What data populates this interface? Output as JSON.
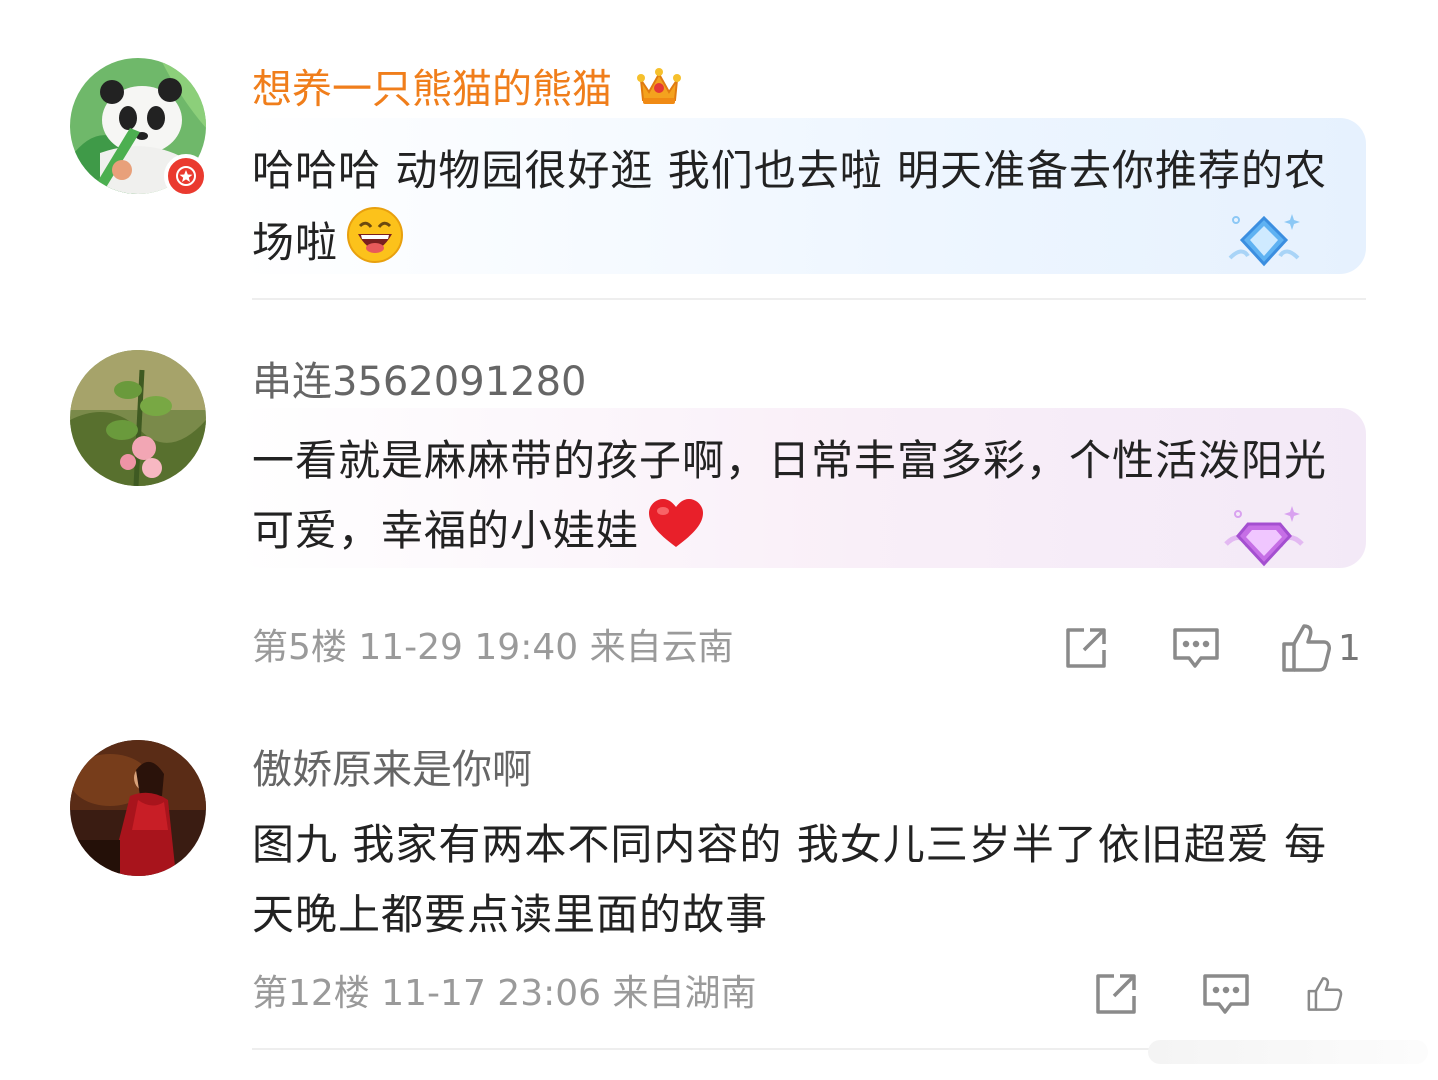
{
  "comments": [
    {
      "username": "想养一只熊猫的熊猫",
      "text": "哈哈哈 动物园很好逛 我们也去啦 明天准备去你推荐的农场啦",
      "emoji": "laughing-emoji",
      "avatar_icon": "panda-avatar",
      "badge_icon": "red-star-badge",
      "vip_icon": "crown-icon",
      "deco_icon": "blue-diamond-icon"
    },
    {
      "username": "串连3562091280",
      "text": "一看就是麻麻带的孩子啊，日常丰富多彩，个性活泼阳光可爱，幸福的小娃娃",
      "emoji": "red-heart-emoji",
      "floor_meta": "第5楼 11-29 19:40 来自云南",
      "like_count": "1",
      "avatar_icon": "plant-avatar",
      "deco_icon": "purple-diamond-icon"
    },
    {
      "username": "傲娇原来是你啊",
      "text": "图九 我家有两本不同内容的 我女儿三岁半了依旧超爱  每天晚上都要点读里面的故事",
      "floor_meta": "第12楼 11-17 23:06 来自湖南",
      "like_count": "",
      "avatar_icon": "red-dress-avatar"
    }
  ],
  "colors": {
    "vip_name": "#f07e1b",
    "name": "#666666",
    "meta": "#9a9a9a",
    "badge": "#ea3a2f"
  }
}
